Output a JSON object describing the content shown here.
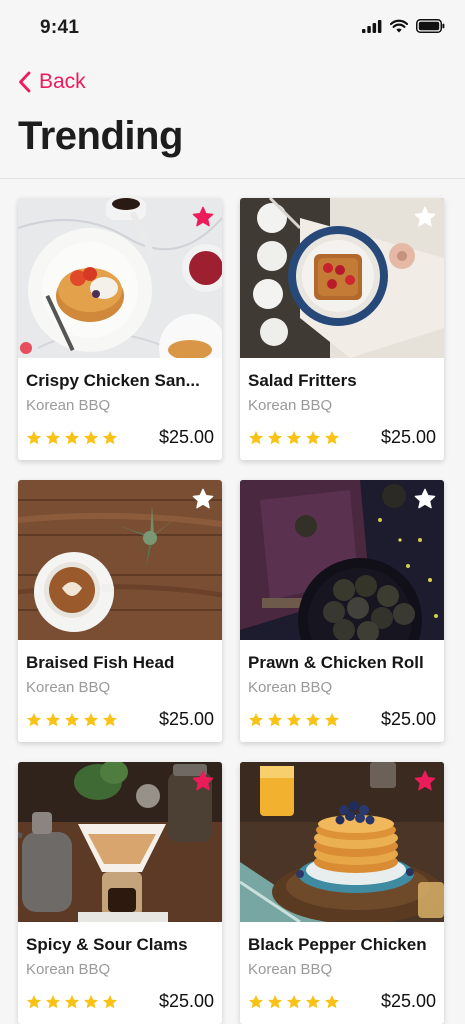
{
  "status_bar": {
    "time": "9:41"
  },
  "nav": {
    "back_label": "Back"
  },
  "page": {
    "title": "Trending"
  },
  "colors": {
    "accent": "#ec1c5a",
    "star": "#f8c316",
    "favorite_active": "#ec1c5a",
    "favorite_inactive": "#ffffff"
  },
  "items": [
    {
      "name": "Crispy Chicken San...",
      "category": "Korean BBQ",
      "rating": 5,
      "price": "$25.00",
      "favorite": true,
      "image": "pancakes-on-marble"
    },
    {
      "name": "Salad Fritters",
      "category": "Korean BBQ",
      "rating": 5,
      "price": "$25.00",
      "favorite": false,
      "image": "toast-on-blue-plate"
    },
    {
      "name": "Braised Fish Head",
      "category": "Korean BBQ",
      "rating": 5,
      "price": "$25.00",
      "favorite": false,
      "image": "latte-on-wood"
    },
    {
      "name": "Prawn & Chicken Roll",
      "category": "Korean BBQ",
      "rating": 5,
      "price": "$25.00",
      "favorite": false,
      "image": "energy-balls-dark"
    },
    {
      "name": "Spicy & Sour Clams",
      "category": "Korean BBQ",
      "rating": 5,
      "price": "$25.00",
      "favorite": true,
      "image": "pour-over-coffee"
    },
    {
      "name": "Black Pepper Chicken",
      "category": "Korean BBQ",
      "rating": 5,
      "price": "$25.00",
      "favorite": true,
      "image": "blueberry-pancakes"
    }
  ]
}
